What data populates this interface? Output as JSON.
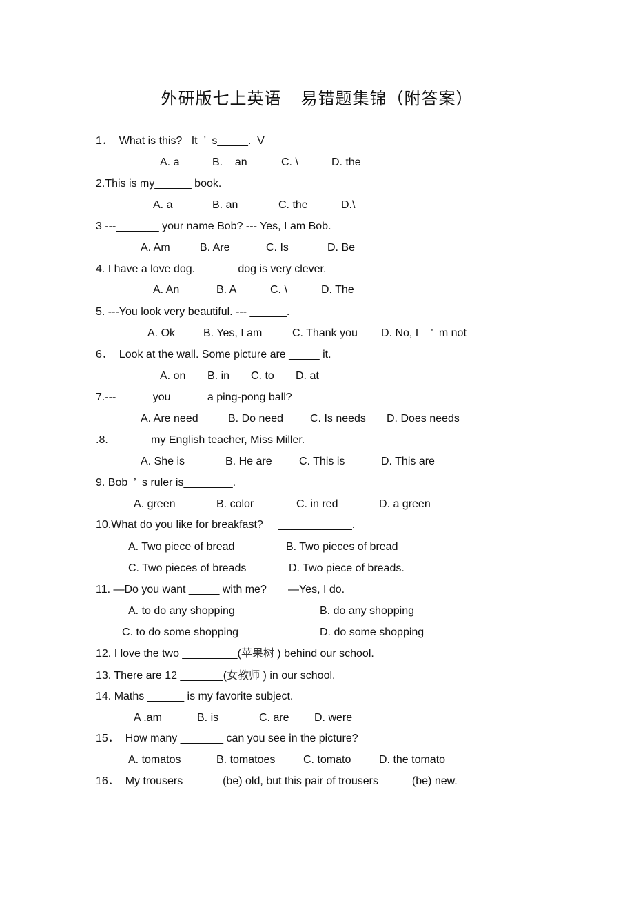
{
  "document": {
    "title_part1": "外研版七上英语",
    "title_part2": "易错题集锦（附答案）",
    "questions": [
      {
        "stem": "1．  What is this?   It  ’  s_____.  V",
        "options": [
          "A. a",
          "B.    an",
          "C. \\",
          "D. the"
        ]
      },
      {
        "stem": "2.This is my______ book.",
        "options": [
          "A. a",
          "B. an",
          "C. the",
          "D.\\"
        ]
      },
      {
        "stem": "3 ---_______ your name Bob? --- Yes, I am Bob.",
        "options": [
          "A. Am",
          "B. Are",
          "C. Is",
          "D. Be"
        ]
      },
      {
        "stem": "4. I have a love dog. ______ dog is very clever.",
        "options": [
          "A. An",
          "B. A",
          "C. \\",
          "D. The"
        ]
      },
      {
        "stem": "5. ---You look very beautiful. --- ______.",
        "options": [
          "A. Ok",
          "B. Yes, I am",
          "C. Thank you",
          "D. No, I    ’  m not"
        ]
      },
      {
        "stem": "6．  Look at the wall. Some picture are _____ it.",
        "options": [
          "A. on",
          "B. in",
          "C. to",
          "D. at"
        ]
      },
      {
        "stem": "7.---______you _____ a ping-pong ball?",
        "options": [
          "A. Are need",
          "B. Do need",
          "C. Is needs",
          "D. Does needs"
        ]
      },
      {
        "stem": ".8. ______ my English teacher, Miss Miller.",
        "options": [
          "A. She is",
          "B. He are",
          "C. This is",
          "D. This are"
        ]
      },
      {
        "stem": "9. Bob  ’  s ruler is________.",
        "options": [
          "A. green",
          "B. color",
          "C. in red",
          "D. a green"
        ]
      },
      {
        "stem": "10.What do you like for breakfast?     ____________.",
        "options": [
          "A. Two piece of bread",
          "B. Two pieces of bread",
          "C. Two pieces of breads",
          "D. Two piece of breads."
        ]
      },
      {
        "stem": "11. —Do you want _____ with me?       —Yes, I do.",
        "options": [
          "A. to do any shopping",
          "B. do any shopping",
          "C. to do some shopping",
          "D. do some shopping"
        ]
      },
      {
        "stem_before": "12. I love the two _________(",
        "stem_cjk": "苹果树",
        "stem_after": " ) behind our school."
      },
      {
        "stem_before": "13. There are 12 _______(",
        "stem_cjk": "女教师",
        "stem_after": " ) in our school."
      },
      {
        "stem": "14. Maths ______ is my favorite subject.",
        "options": [
          "A .am",
          "B. is",
          "C. are",
          "D. were"
        ]
      },
      {
        "stem": "15．  How many _______ can you see in the picture?",
        "options": [
          "A. tomatos",
          "B. tomatoes",
          "C. tomato",
          "D. the tomato"
        ]
      },
      {
        "stem": "16．  My trousers ______(be) old, but this pair of trousers _____(be) new."
      }
    ]
  }
}
